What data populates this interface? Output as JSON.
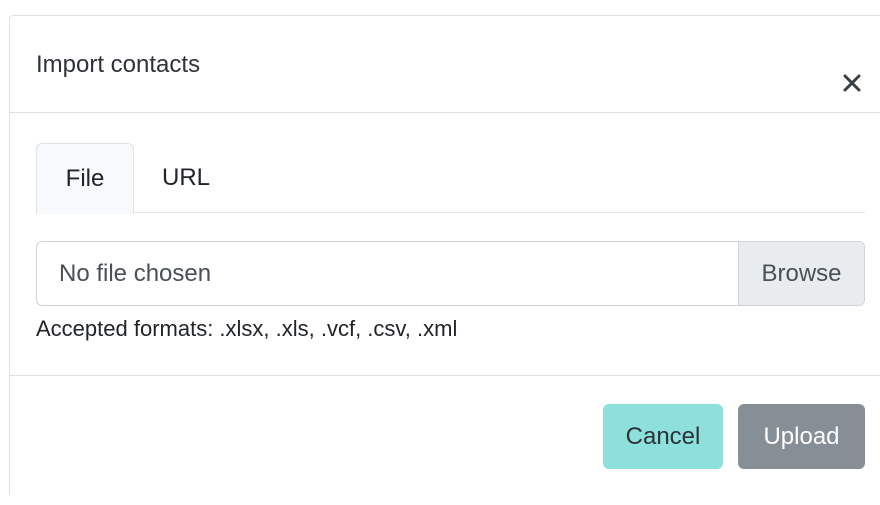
{
  "modal": {
    "title": "Import contacts",
    "close_icon": "close-icon"
  },
  "tabs": [
    {
      "label": "File",
      "active": true
    },
    {
      "label": "URL",
      "active": false
    }
  ],
  "file_input": {
    "value": "No file chosen",
    "browse_label": "Browse"
  },
  "help_text": "Accepted formats: .xlsx, .xls, .vcf, .csv, .xml",
  "footer": {
    "cancel_label": "Cancel",
    "upload_label": "Upload"
  },
  "colors": {
    "cancel_bg": "#8ee0dc",
    "upload_bg": "#868e96",
    "border": "#dee2e6"
  }
}
